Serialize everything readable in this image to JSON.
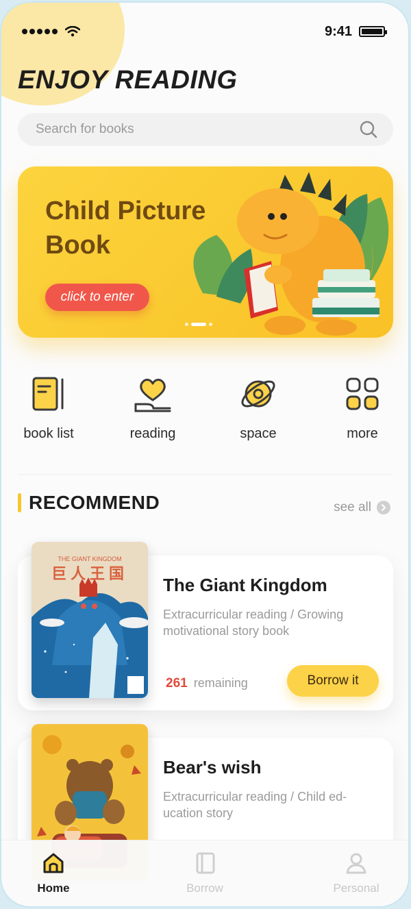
{
  "status_bar": {
    "time": "9:41"
  },
  "header": {
    "title": "ENJOY READING"
  },
  "search": {
    "placeholder": "Search for books"
  },
  "banner": {
    "title": "Child Picture Book",
    "button_label": "click to enter",
    "active_slide": 2,
    "slide_count": 3
  },
  "categories": [
    {
      "label": "book list",
      "icon": "book-list-icon"
    },
    {
      "label": "reading",
      "icon": "heart-hand-icon"
    },
    {
      "label": "space",
      "icon": "planet-icon"
    },
    {
      "label": "more",
      "icon": "grid-icon"
    }
  ],
  "recommend": {
    "title": "RECOMMEND",
    "see_all": "see all",
    "books": [
      {
        "title": "The Giant Kingdom",
        "description": "Extracurricular reading / Growing motivational story book",
        "remaining_count": "261",
        "remaining_label": "remaining",
        "button_label": "Borrow it",
        "cover_title": "THE GIANT KINGDOM",
        "cover_chinese": "巨人王国"
      },
      {
        "title": "Bear's wish",
        "description": "Extracurricular reading  / Child ed-ucation story"
      }
    ]
  },
  "tabbar": {
    "tabs": [
      {
        "label": "Home",
        "icon": "home-icon",
        "active": true
      },
      {
        "label": "Borrow",
        "icon": "borrow-icon",
        "active": false
      },
      {
        "label": "Personal",
        "icon": "person-icon",
        "active": false
      }
    ]
  },
  "colors": {
    "accent_yellow": "#fcd248",
    "banner_yellow": "#fcd43e",
    "button_red": "#f0574a",
    "count_red": "#e24a3a",
    "title_brown": "#6f4a12"
  }
}
